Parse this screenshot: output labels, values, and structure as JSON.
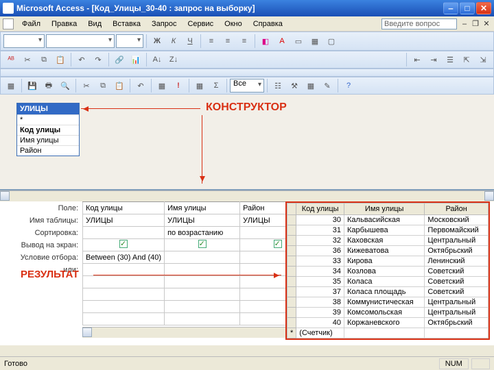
{
  "window": {
    "title": "Microsoft Access - [Код_Улицы_30-40 : запрос на выборку]"
  },
  "menu": {
    "items": [
      "Файл",
      "Правка",
      "Вид",
      "Вставка",
      "Запрос",
      "Сервис",
      "Окно",
      "Справка"
    ],
    "ask_placeholder": "Введите вопрос"
  },
  "toolbar3": {
    "combo_text": "Все"
  },
  "table_card": {
    "title": "УЛИЦЫ",
    "fields": [
      "*",
      "Код улицы",
      "Имя улицы",
      "Район"
    ]
  },
  "annot": {
    "designer": "КОНСТРУКТОР",
    "result": "РЕЗУЛЬТАТ"
  },
  "grid_labels": [
    "Поле:",
    "Имя таблицы:",
    "Сортировка:",
    "Вывод на экран:",
    "Условие отбора:",
    "или:"
  ],
  "grid": {
    "cols": [
      {
        "field": "Код улицы",
        "table": "УЛИЦЫ",
        "sort": "",
        "show": true,
        "crit": "Between (30) And (40)"
      },
      {
        "field": "Имя улицы",
        "table": "УЛИЦЫ",
        "sort": "по возрастанию",
        "show": true,
        "crit": ""
      },
      {
        "field": "Район",
        "table": "УЛИЦЫ",
        "sort": "",
        "show": true,
        "crit": ""
      }
    ]
  },
  "result": {
    "headers": [
      "Код улицы",
      "Имя улицы",
      "Район"
    ],
    "rows": [
      [
        "30",
        "Кальвасийская",
        "Московский"
      ],
      [
        "31",
        "Карбышева",
        "Первомайский"
      ],
      [
        "32",
        "Каховская",
        "Центральный"
      ],
      [
        "36",
        "Кижеватова",
        "Октябрьский"
      ],
      [
        "33",
        "Кирова",
        "Ленинский"
      ],
      [
        "34",
        "Козлова",
        "Советский"
      ],
      [
        "35",
        "Коласа",
        "Советский"
      ],
      [
        "37",
        "Коласа площадь",
        "Советский"
      ],
      [
        "38",
        "Коммунистическая",
        "Центральный"
      ],
      [
        "39",
        "Комсомольская",
        "Центральный"
      ],
      [
        "40",
        "Коржаневского",
        "Октябрьский"
      ]
    ],
    "counter": "(Счетчик)"
  },
  "status": {
    "left": "Готово",
    "num": "NUM"
  }
}
